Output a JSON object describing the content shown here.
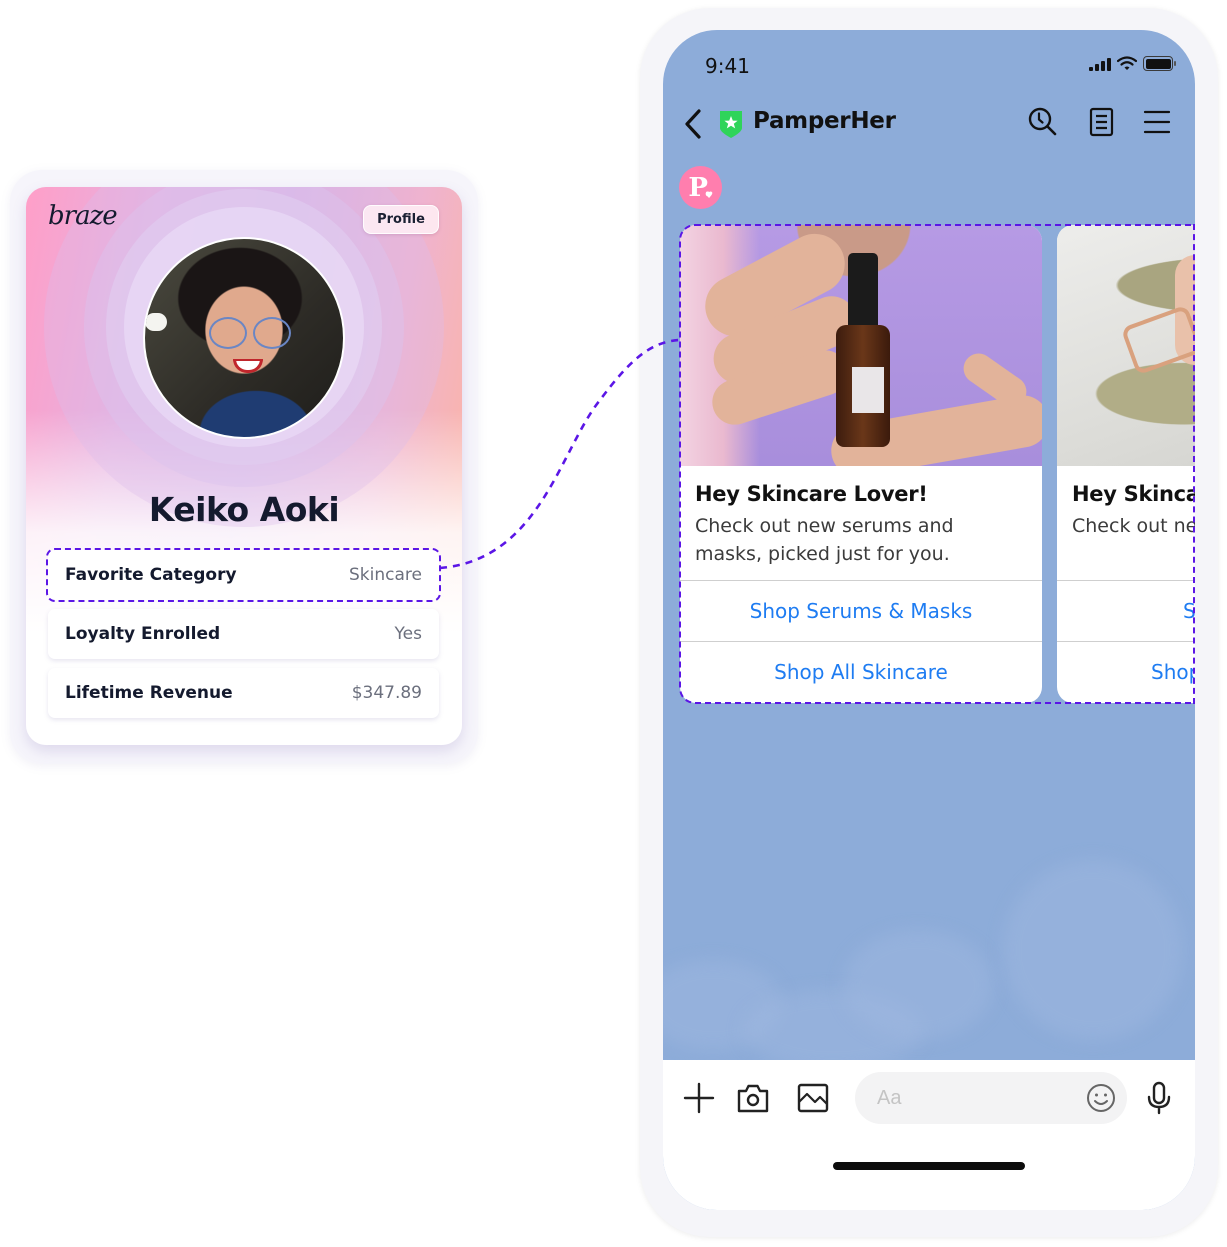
{
  "profile_card": {
    "logo": "braze",
    "profile_button": "Profile",
    "name": "Keiko Aoki",
    "attributes": [
      {
        "label": "Favorite Category",
        "value": "Skincare",
        "highlighted": true
      },
      {
        "label": "Loyalty Enrolled",
        "value": "Yes",
        "highlighted": false
      },
      {
        "label": "Lifetime Revenue",
        "value": "$347.89",
        "highlighted": false
      }
    ]
  },
  "phone": {
    "status_bar": {
      "time": "9:41",
      "icons": [
        "signal-icon",
        "wifi-icon",
        "battery-icon"
      ]
    },
    "nav": {
      "back_icon": "chevron-left-icon",
      "verified_icon": "green-shield-star-icon",
      "title": "PamperHer",
      "actions": [
        "history-search-icon",
        "document-icon",
        "menu-icon"
      ]
    },
    "brand_avatar_letter": "P.",
    "messages": [
      {
        "title": "Hey Skincare Lover!",
        "text_line1": "Check out new serums and",
        "text_line2": "masks, picked just for you.",
        "buttons": [
          "Shop Serums & Masks",
          "Shop All Skincare"
        ]
      },
      {
        "title": "Hey Skincare Lover!",
        "text_line1": "Check out new serums and",
        "text_line2": "",
        "buttons": [
          "Shop Serums & Masks",
          "Shop All Skincare"
        ]
      }
    ],
    "composer": {
      "placeholder": "Aa",
      "icons": [
        "plus-icon",
        "camera-icon",
        "image-icon",
        "emoji-icon",
        "microphone-icon"
      ]
    }
  },
  "colors": {
    "highlight_dash": "#5b16e6",
    "link_blue": "#1e7cf2",
    "chat_background": "#8dacd9",
    "brand_pink": "#ff7eae",
    "verified_green": "#2fd45a"
  }
}
